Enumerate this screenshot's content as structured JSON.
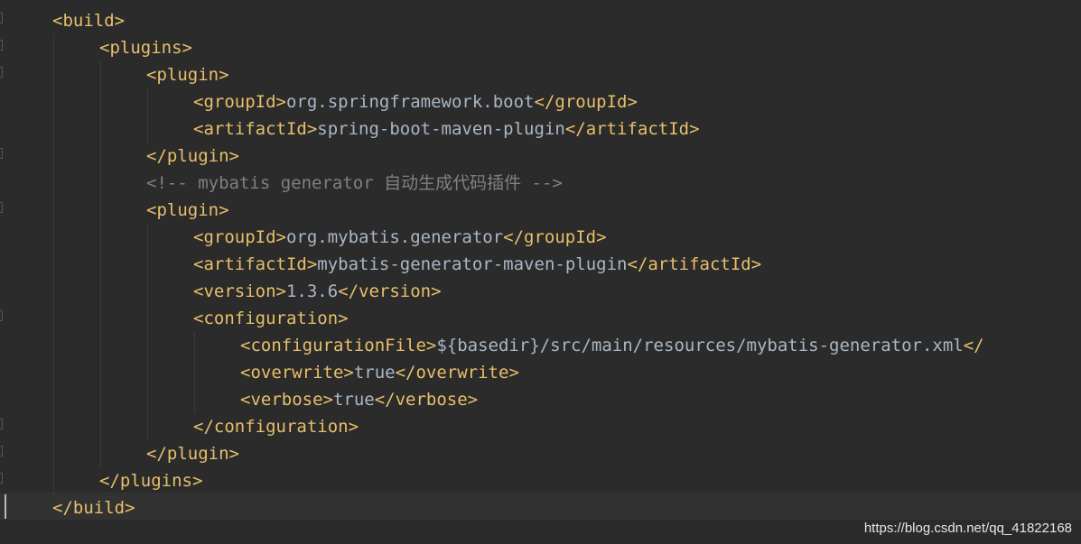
{
  "code": {
    "lines": [
      {
        "open": "<build>"
      },
      {
        "open": "<plugins>"
      },
      {
        "open": "<plugin>"
      },
      {
        "open": "<groupId>",
        "text": "org.springframework.boot",
        "close": "</groupId>"
      },
      {
        "open": "<artifactId>",
        "text": "spring-boot-maven-plugin",
        "close": "</artifactId>"
      },
      {
        "open": "</plugin>"
      },
      {
        "comment": "<!-- mybatis generator 自动生成代码插件 -->"
      },
      {
        "open": "<plugin>"
      },
      {
        "open": "<groupId>",
        "text": "org.mybatis.generator",
        "close": "</groupId>"
      },
      {
        "open": "<artifactId>",
        "text": "mybatis-generator-maven-plugin",
        "close": "</artifactId>"
      },
      {
        "open": "<version>",
        "text": "1.3.6",
        "close": "</version>"
      },
      {
        "open": "<configuration>"
      },
      {
        "open": "<configurationFile>",
        "text": "${basedir}/src/main/resources/mybatis-generator.xml",
        "close": "</"
      },
      {
        "open": "<overwrite>",
        "text": "true",
        "close": "</overwrite>"
      },
      {
        "open": "<verbose>",
        "text": "true",
        "close": "</verbose>"
      },
      {
        "open": "</configuration>"
      },
      {
        "open": "</plugin>"
      },
      {
        "open": "</plugins>"
      },
      {
        "open": "</build>"
      }
    ]
  },
  "watermark": {
    "text": "https://blog.csdn.net/qq_41822168"
  },
  "colors": {
    "background": "#2b2b2b",
    "tag": "#e8bf6a",
    "text": "#a9b7c6",
    "comment": "#808080"
  }
}
